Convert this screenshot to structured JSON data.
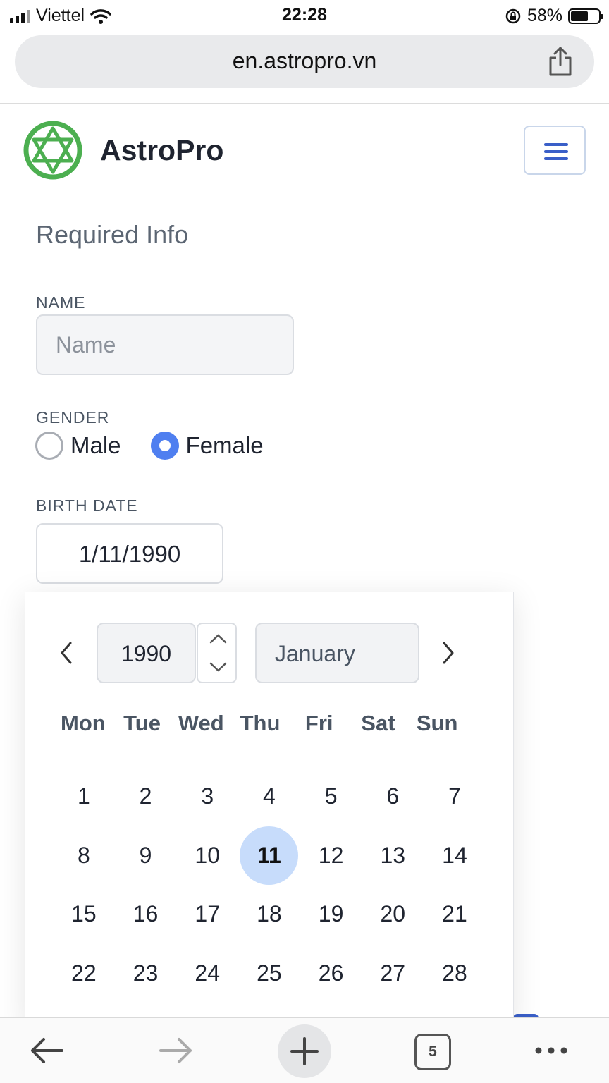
{
  "status_bar": {
    "carrier": "Viettel",
    "time": "22:28",
    "battery": "58%"
  },
  "browser": {
    "url": "en.astropro.vn",
    "open_tabs": "5"
  },
  "header": {
    "brand": "AstroPro"
  },
  "form": {
    "title": "Required Info",
    "name_label": "NAME",
    "name_placeholder": "Name",
    "name_value": "",
    "gender_label": "GENDER",
    "gender_options": [
      "Male",
      "Female"
    ],
    "gender_selected": "Female",
    "birth_date_label": "BIRTH DATE",
    "birth_date_value": "1/11/1990"
  },
  "datepicker": {
    "year": "1990",
    "month": "January",
    "weekdays": [
      "Mon",
      "Tue",
      "Wed",
      "Thu",
      "Fri",
      "Sat",
      "Sun"
    ],
    "days": [
      "1",
      "2",
      "3",
      "4",
      "5",
      "6",
      "7",
      "8",
      "9",
      "10",
      "11",
      "12",
      "13",
      "14",
      "15",
      "16",
      "17",
      "18",
      "19",
      "20",
      "21",
      "22",
      "23",
      "24",
      "25",
      "26",
      "27",
      "28"
    ],
    "selected_day": "11"
  },
  "colors": {
    "accent": "#4f7ff0",
    "selected_day_bg": "#c7dcfb",
    "logo_green": "#4caf50",
    "menu_blue": "#3a5fc8"
  }
}
